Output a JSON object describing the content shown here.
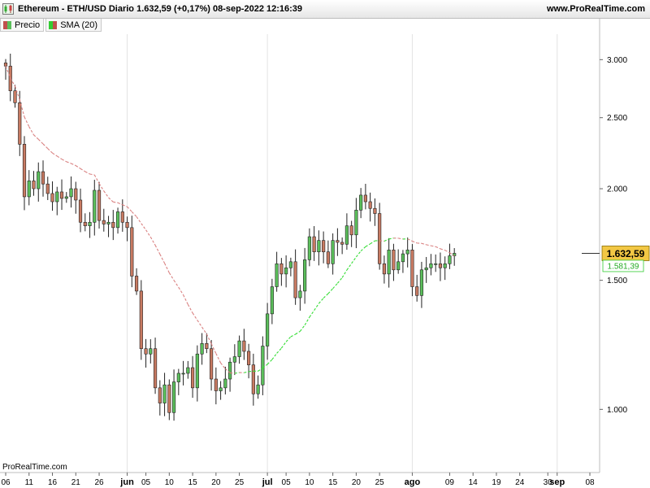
{
  "header": {
    "title": "Ethereum - ETH/USD Diario 1.632,59 (+0,17%) 08-sep-2022 12:16:39",
    "site": "www.ProRealTime.com"
  },
  "legend": [
    {
      "label": "Precio",
      "color": "#c0504d"
    },
    {
      "label": "SMA (20)",
      "color": "#33cc33"
    }
  ],
  "footer": {
    "brand": "ProRealTime.com"
  },
  "colors": {
    "up": "#5bbf5b",
    "down": "#c87a62",
    "sma_down": "#d98080",
    "sma_up": "#33dd33",
    "price_tag": "#f2c744"
  },
  "chart_data": {
    "type": "candlestick",
    "title": "Ethereum - ETH/USD Diario",
    "y_scale": "log",
    "ylim": [
      820,
      3250
    ],
    "y_ticks": [
      {
        "value": 3000,
        "label": "3.000"
      },
      {
        "value": 2500,
        "label": "2.500"
      },
      {
        "value": 2000,
        "label": "2.000"
      },
      {
        "value": 1500,
        "label": "1.500"
      },
      {
        "value": 1000,
        "label": "1.000"
      }
    ],
    "x_start": "2022-05-06",
    "x_end": "2022-09-08",
    "x_ticks": [
      {
        "date": "2022-05-06",
        "label": "06",
        "bold": false
      },
      {
        "date": "2022-05-11",
        "label": "11",
        "bold": false
      },
      {
        "date": "2022-05-16",
        "label": "16",
        "bold": false
      },
      {
        "date": "2022-05-21",
        "label": "21",
        "bold": false
      },
      {
        "date": "2022-05-26",
        "label": "26",
        "bold": false
      },
      {
        "date": "2022-06-01",
        "label": "jun",
        "bold": true
      },
      {
        "date": "2022-06-05",
        "label": "05",
        "bold": false
      },
      {
        "date": "2022-06-10",
        "label": "10",
        "bold": false
      },
      {
        "date": "2022-06-15",
        "label": "15",
        "bold": false
      },
      {
        "date": "2022-06-20",
        "label": "20",
        "bold": false
      },
      {
        "date": "2022-06-25",
        "label": "25",
        "bold": false
      },
      {
        "date": "2022-07-01",
        "label": "jul",
        "bold": true
      },
      {
        "date": "2022-07-05",
        "label": "05",
        "bold": false
      },
      {
        "date": "2022-07-10",
        "label": "10",
        "bold": false
      },
      {
        "date": "2022-07-15",
        "label": "15",
        "bold": false
      },
      {
        "date": "2022-07-20",
        "label": "20",
        "bold": false
      },
      {
        "date": "2022-07-25",
        "label": "25",
        "bold": false
      },
      {
        "date": "2022-08-01",
        "label": "ago",
        "bold": true
      },
      {
        "date": "2022-08-09",
        "label": "09",
        "bold": false
      },
      {
        "date": "2022-08-14",
        "label": "14",
        "bold": false
      },
      {
        "date": "2022-08-19",
        "label": "19",
        "bold": false
      },
      {
        "date": "2022-08-24",
        "label": "24",
        "bold": false
      },
      {
        "date": "2022-08-30",
        "label": "30",
        "bold": false
      },
      {
        "date": "2022-09-01",
        "label": "sep",
        "bold": true
      },
      {
        "date": "2022-09-08",
        "label": "08",
        "bold": false
      }
    ],
    "gridlines_x": [
      "2022-06-01",
      "2022-07-01",
      "2022-08-01",
      "2022-09-01"
    ],
    "close": [
      2940,
      2720,
      2620,
      2300,
      1950,
      2050,
      2000,
      2110,
      2030,
      1970,
      1920,
      1980,
      1940,
      1950,
      2000,
      1930,
      1800,
      1780,
      1800,
      1990,
      1810,
      1790,
      1800,
      1770,
      1860,
      1800,
      1770,
      1520,
      1450,
      1210,
      1190,
      1210,
      1070,
      1020,
      1080,
      990,
      1090,
      1120,
      1120,
      1140,
      1070,
      1190,
      1230,
      1210,
      1100,
      1060,
      1070,
      1100,
      1160,
      1180,
      1240,
      1200,
      1150,
      1050,
      1080,
      1220,
      1350,
      1470,
      1580,
      1530,
      1560,
      1590,
      1420,
      1450,
      1600,
      1720,
      1640,
      1700,
      1640,
      1580,
      1700,
      1690,
      1680,
      1780,
      1730,
      1870,
      1960,
      1920,
      1880,
      1850,
      1580,
      1530,
      1650,
      1550,
      1590,
      1630,
      1650,
      1470,
      1430,
      1550,
      1560,
      1580,
      1580,
      1560,
      1580,
      1620,
      1632.59
    ],
    "series": [
      {
        "name": "Precio",
        "type": "candles"
      },
      {
        "name": "SMA (20)",
        "type": "line",
        "last_value": 1581.39,
        "last_label": "1.581,39"
      }
    ],
    "last_price": {
      "value": 1632.59,
      "label": "1.632,59"
    }
  }
}
